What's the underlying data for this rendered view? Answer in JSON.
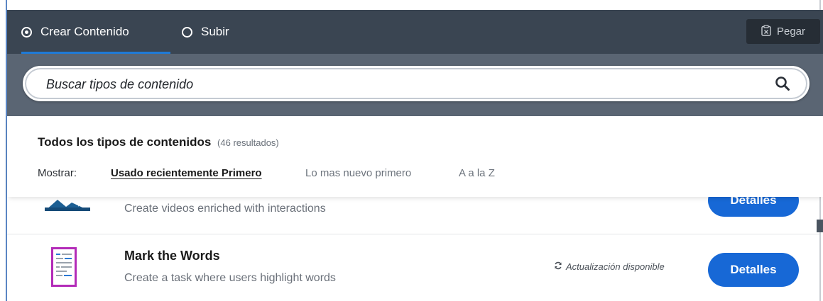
{
  "tabs": [
    {
      "label": "Crear Contenido",
      "selected": true
    },
    {
      "label": "Subir",
      "selected": false
    }
  ],
  "paste": {
    "label": "Pegar",
    "icon": "clipboard-icon"
  },
  "search": {
    "placeholder": "Buscar tipos de contenido",
    "icon": "search-icon"
  },
  "filter": {
    "title": "Todos los tipos de contenidos",
    "count": "(46 resultados)",
    "show_label": "Mostrar:",
    "sort_options": [
      "Usado recientemente Primero",
      "Lo mas nuevo primero",
      "A a la Z"
    ],
    "active_sort": "Usado recientemente Primero"
  },
  "items": [
    {
      "title": "",
      "description": "Create videos enriched with interactions",
      "button": "Detalles",
      "icon": "interactive-video-icon"
    },
    {
      "title": "Mark the Words",
      "description": "Create a task where users highlight words",
      "update": "Actualización disponible",
      "button": "Detalles",
      "icon": "mark-the-words-icon"
    }
  ],
  "colors": {
    "topbar": "#3a4552",
    "search_band": "#5a6573",
    "accent_blue": "#1768d6",
    "tab_underline": "#1f7ad6",
    "mark_words_icon": "#b32bb8"
  }
}
